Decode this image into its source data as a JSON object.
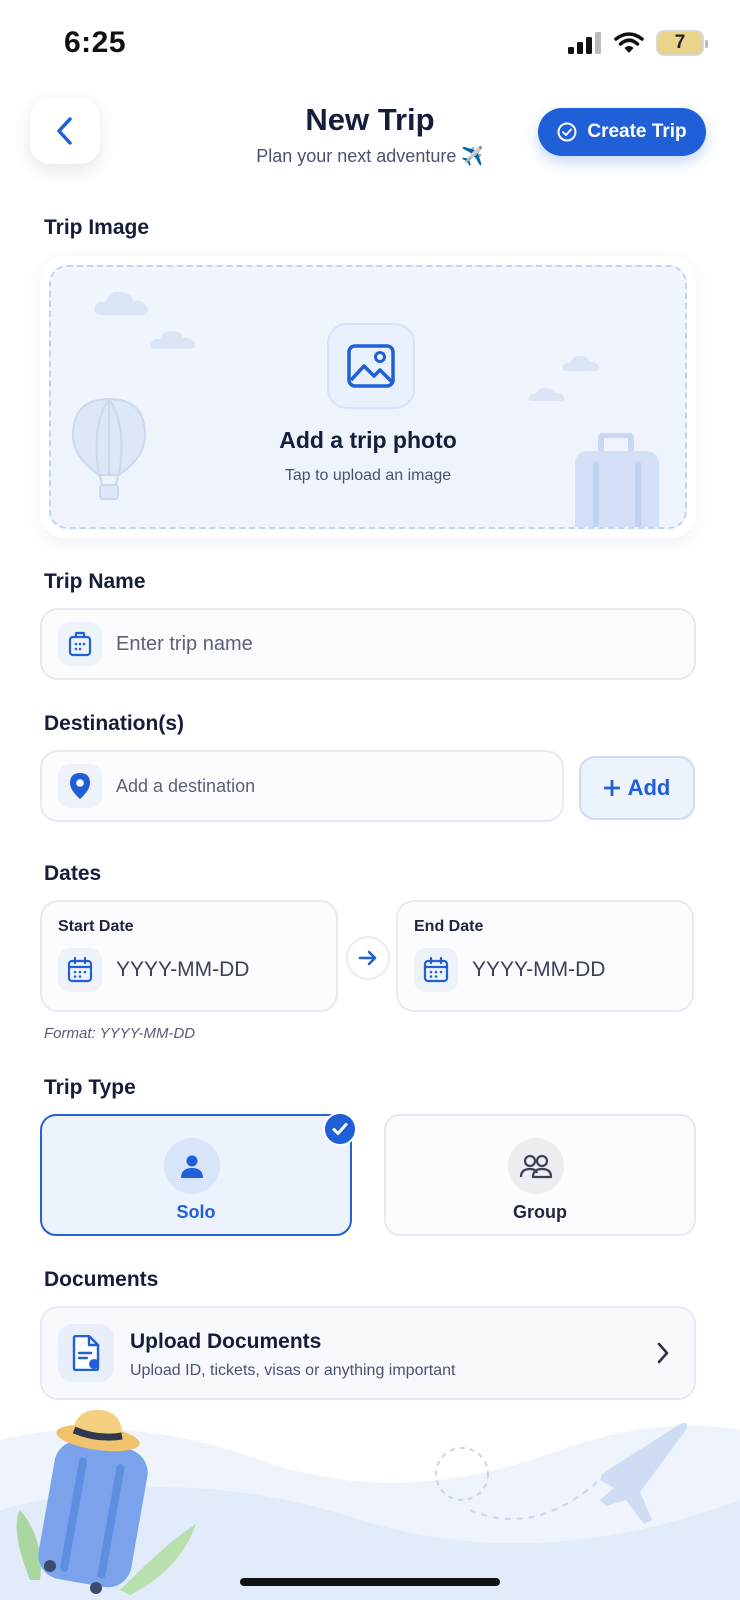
{
  "status_bar": {
    "time": "6:25",
    "battery": "7"
  },
  "header": {
    "title": "New Trip",
    "subtitle": "Plan your next adventure ✈️",
    "create_label": "Create Trip"
  },
  "trip_image": {
    "label": "Trip Image",
    "title": "Add a trip photo",
    "subtitle": "Tap to upload an image"
  },
  "trip_name": {
    "label": "Trip Name",
    "placeholder": "Enter trip name"
  },
  "destinations": {
    "label": "Destination(s)",
    "placeholder": "Add a destination",
    "add_label": "Add"
  },
  "dates": {
    "label": "Dates",
    "start_label": "Start Date",
    "start_value": "YYYY-MM-DD",
    "end_label": "End Date",
    "end_value": "YYYY-MM-DD",
    "format_hint": "Format: YYYY-MM-DD"
  },
  "trip_type": {
    "label": "Trip Type",
    "options": [
      {
        "label": "Solo",
        "selected": true
      },
      {
        "label": "Group",
        "selected": false
      }
    ]
  },
  "documents": {
    "label": "Documents",
    "title": "Upload Documents",
    "subtitle": "Upload ID, tickets, visas or anything important"
  },
  "colors": {
    "accent": "#1f5fd8",
    "selected_bg": "#edf3fd",
    "text": "#141d3a"
  }
}
